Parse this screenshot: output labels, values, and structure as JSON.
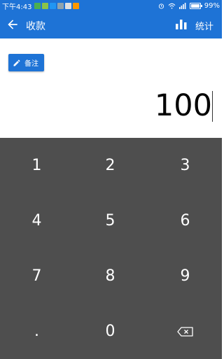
{
  "status_bar": {
    "time": "下午4:43",
    "battery": "99%",
    "battery_level": 0.99,
    "notification_colors": [
      "#4caf50",
      "#8bc34a",
      "#2196f3",
      "#90a4ae",
      "#e0e0e0",
      "#ff9800"
    ]
  },
  "app_bar": {
    "title": "收款",
    "stats_label": "统计"
  },
  "note_button": {
    "label": "备注"
  },
  "amount": "100",
  "keypad": {
    "keys": [
      "1",
      "2",
      "3",
      "4",
      "5",
      "6",
      "7",
      "8",
      "9",
      ".",
      "0"
    ]
  },
  "colors": {
    "primary": "#1e73d6",
    "keypad_bg": "#4e4e4e"
  },
  "icons": [
    "back-arrow-icon",
    "bar-chart-icon",
    "pencil-icon",
    "backspace-icon",
    "wifi-icon",
    "signal-icon",
    "alarm-icon",
    "battery-icon"
  ]
}
